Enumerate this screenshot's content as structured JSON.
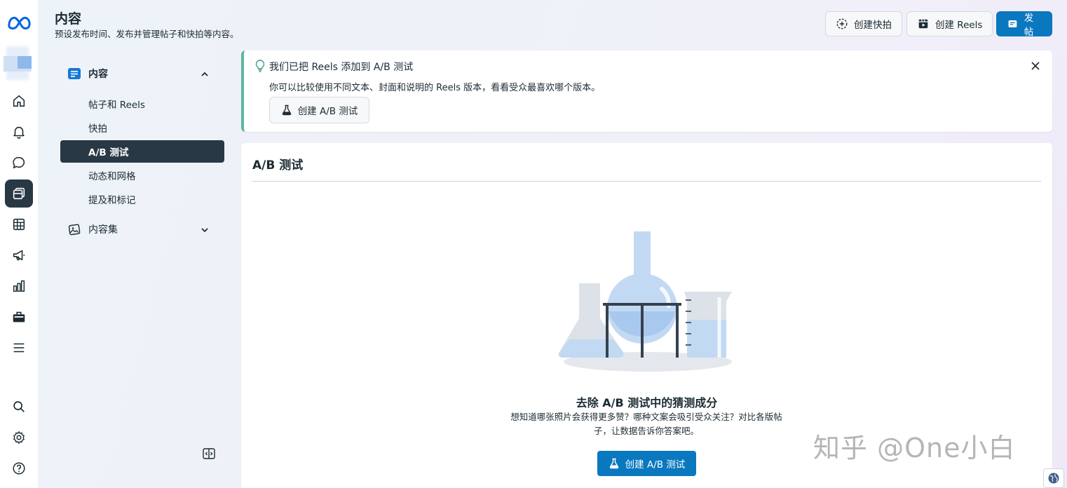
{
  "header": {
    "title": "内容",
    "subtitle": "预设发布时间、发布并管理帖子和快拍等内容。",
    "buttons": {
      "create_story": "创建快拍",
      "create_reels": "创建 Reels",
      "post": "发帖"
    }
  },
  "sidebar": {
    "section_content": "内容",
    "items": [
      {
        "label": "帖子和 Reels",
        "active": false
      },
      {
        "label": "快拍",
        "active": false
      },
      {
        "label": "A/B 测试",
        "active": true
      },
      {
        "label": "动态和网格",
        "active": false
      },
      {
        "label": "提及和标记",
        "active": false
      }
    ],
    "section_collections": "内容集"
  },
  "notice": {
    "title": "我们已把 Reels 添加到 A/B 测试",
    "body": "你可以比较使用不同文本、封面和说明的 Reels 版本，看看受众最喜欢哪个版本。",
    "button": "创建 A/B 测试"
  },
  "main": {
    "title": "A/B 测试",
    "empty_title": "去除 A/B 测试中的猜测成分",
    "empty_desc": "想知道哪张照片会获得更多赞？哪种文案会吸引受众关注？对比各版帖子，让数据告诉你答案吧。",
    "button": "创建 A/B 测试"
  },
  "watermark": "知乎 @One小白",
  "colors": {
    "primary": "#0a78be",
    "dark_active": "#283845",
    "notice_accent": "#5fb5a0",
    "meta_blue": "#0668e1"
  },
  "icons": {
    "rail": [
      "home-icon",
      "bell-icon",
      "chat-icon",
      "content-icon",
      "table-icon",
      "megaphone-icon",
      "insights-icon",
      "briefcase-icon",
      "menu-icon",
      "search-icon",
      "gear-icon",
      "help-icon"
    ]
  }
}
